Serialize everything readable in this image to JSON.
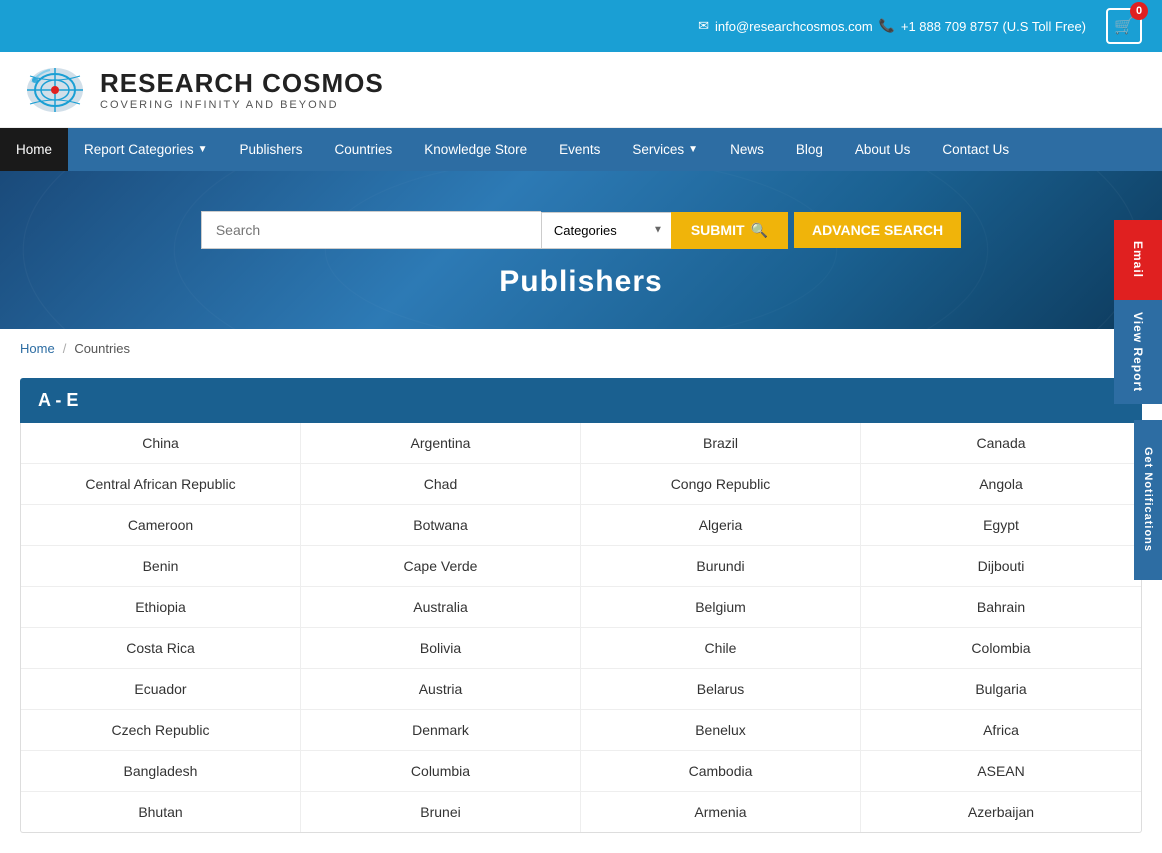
{
  "brand": {
    "title": "RESEARCH COSMOS",
    "subtitle": "COVERING INFINITY AND BEYOND"
  },
  "topbar": {
    "email": "info@researchcosmos.com",
    "phone": "+1 888 709 8757 (U.S Toll Free)",
    "cart_count": "0"
  },
  "nav": {
    "items": [
      {
        "label": "Home",
        "active": true,
        "has_arrow": false
      },
      {
        "label": "Report Categories",
        "active": false,
        "has_arrow": true
      },
      {
        "label": "Publishers",
        "active": false,
        "has_arrow": false
      },
      {
        "label": "Countries",
        "active": false,
        "has_arrow": false
      },
      {
        "label": "Knowledge Store",
        "active": false,
        "has_arrow": false
      },
      {
        "label": "Events",
        "active": false,
        "has_arrow": false
      },
      {
        "label": "Services",
        "active": false,
        "has_arrow": true
      },
      {
        "label": "News",
        "active": false,
        "has_arrow": false
      },
      {
        "label": "Blog",
        "active": false,
        "has_arrow": false
      },
      {
        "label": "About Us",
        "active": false,
        "has_arrow": false
      },
      {
        "label": "Contact Us",
        "active": false,
        "has_arrow": false
      }
    ]
  },
  "hero": {
    "search_placeholder": "Search",
    "categories_label": "Categories",
    "submit_label": "SUBMIT",
    "advance_search_label": "ADVANCE SEARCH",
    "page_title": "Publishers"
  },
  "breadcrumb": {
    "home": "Home",
    "current": "Countries"
  },
  "sections": [
    {
      "id": "a-e",
      "header": "A - E",
      "rows": [
        [
          "China",
          "Argentina",
          "Brazil",
          "Canada"
        ],
        [
          "Central African Republic",
          "Chad",
          "Congo Republic",
          "Angola"
        ],
        [
          "Cameroon",
          "Botwana",
          "Algeria",
          "Egypt"
        ],
        [
          "Benin",
          "Cape Verde",
          "Burundi",
          "Dijbouti"
        ],
        [
          "Ethiopia",
          "Australia",
          "Belgium",
          "Bahrain"
        ],
        [
          "Costa Rica",
          "Bolivia",
          "Chile",
          "Colombia"
        ],
        [
          "Ecuador",
          "Austria",
          "Belarus",
          "Bulgaria"
        ],
        [
          "Czech Republic",
          "Denmark",
          "Benelux",
          "Africa"
        ],
        [
          "Bangladesh",
          "Columbia",
          "Cambodia",
          "ASEAN"
        ],
        [
          "Bhutan",
          "Brunei",
          "Armenia",
          "Azerbaijan"
        ]
      ]
    }
  ],
  "sidebar": {
    "email_btn": "Email",
    "view_report_btn": "View Report",
    "notifications_btn": "Get Notifications"
  }
}
